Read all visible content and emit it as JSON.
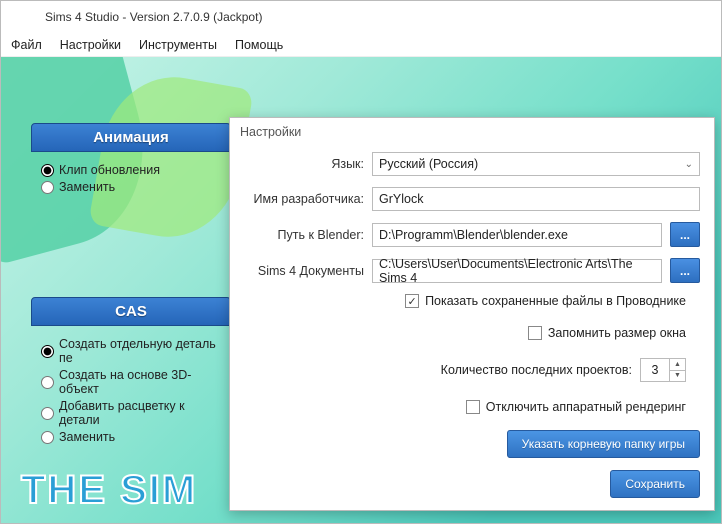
{
  "title": "Sims 4 Studio - Version 2.7.0.9  (Jackpot)",
  "menu": {
    "file": "Файл",
    "settings": "Настройки",
    "tools": "Инструменты",
    "help": "Помощь"
  },
  "logo": "THE SIM",
  "panel_anim": {
    "title": "Анимация",
    "opt1": "Клип обновления",
    "opt2": "Заменить"
  },
  "panel_cas": {
    "title": "CAS",
    "opt1": "Создать отдельную деталь пе",
    "opt2": "Создать на основе 3D-объект",
    "opt3": "Добавить расцветку к детали",
    "opt4": "Заменить"
  },
  "settings": {
    "title": "Настройки",
    "lang_label": "Язык:",
    "lang_value": "Русский (Россия)",
    "dev_label": "Имя разработчика:",
    "dev_value": "GrYlock",
    "blender_label": "Путь к Blender:",
    "blender_value": "D:\\Programm\\Blender\\blender.exe",
    "docs_label": "Sims 4 Документы",
    "docs_value": "C:\\Users\\User\\Documents\\Electronic Arts\\The Sims 4",
    "browse": "...",
    "chk_show": "Показать сохраненные файлы в Проводнике",
    "chk_remember": "Запомнить размер окна",
    "recent_label": "Количество последних проектов:",
    "recent_value": "3",
    "chk_hw": "Отключить аппаратный рендеринг",
    "btn_root": "Указать корневую папку игры",
    "btn_save": "Сохранить"
  }
}
